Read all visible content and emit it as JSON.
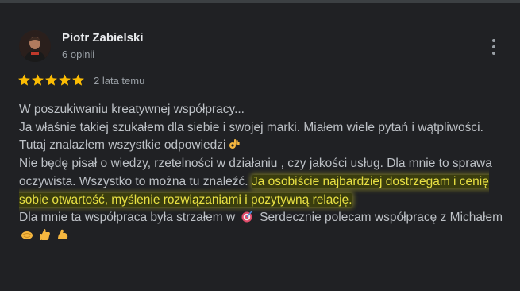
{
  "review": {
    "author_name": "Piotr Zabielski",
    "author_reviews": "6 opinii",
    "rating": 5,
    "max_rating": 5,
    "date": "2 lata temu",
    "lines": {
      "l1": "W poszukiwaniu kreatywnej współpracy...",
      "l2": "Ja właśnie takiej szukałem dla siebie i swojej marki. Miałem wiele pytań i wątpliwości. Tutaj znalazłem wszystkie odpowiedzi",
      "l3": "Nie będę pisał o wiedzy, rzetelności w działaniu , czy jakości usług. Dla mnie to sprawa oczywista. Wszystko to można tu znaleźć.",
      "l3_highlight": "Ja osobiście najbardziej dostrzegam i cenię sobie otwartość, myślenie rozwiązaniami i pozytywną relację.",
      "l4_a": "Dla mnie ta współpraca była strzałem w",
      "l4_b": "Serdecznie polecam współpracę z Michałem"
    },
    "emojis": [
      "ok-hand-icon",
      "bullseye-icon",
      "handshake-icon",
      "thumbs-up-icon",
      "flexed-biceps-icon"
    ]
  },
  "colors": {
    "background": "#202124",
    "star": "#fbbc04",
    "highlight_text": "#e8e043"
  }
}
